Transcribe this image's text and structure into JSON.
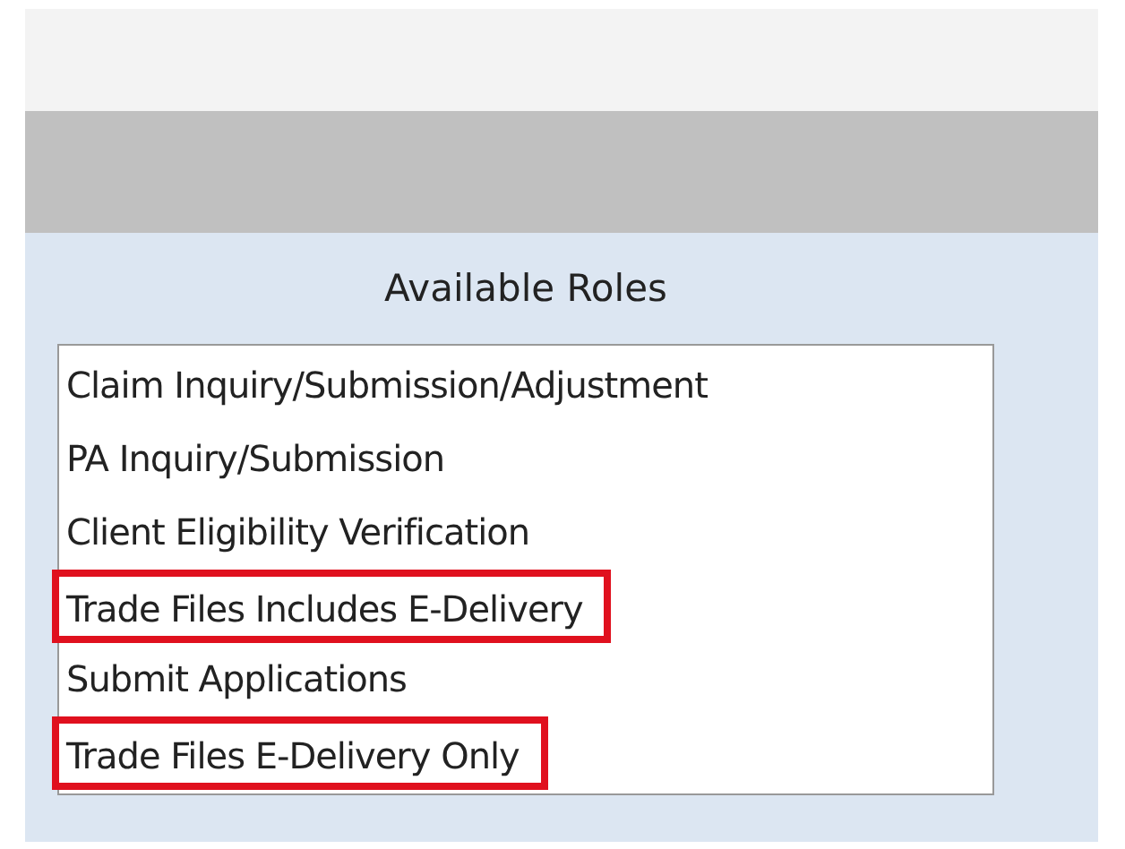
{
  "panel": {
    "title": "Available Roles"
  },
  "roles": [
    {
      "label": "Claim Inquiry/Submission/Adjustment",
      "highlighted": false
    },
    {
      "label": "PA Inquiry/Submission",
      "highlighted": false
    },
    {
      "label": "Client Eligibility Verification",
      "highlighted": false
    },
    {
      "label": "Trade Files Includes E-Delivery",
      "highlighted": true
    },
    {
      "label": "Submit Applications",
      "highlighted": false
    },
    {
      "label": "Trade Files E-Delivery Only",
      "highlighted": true
    }
  ]
}
